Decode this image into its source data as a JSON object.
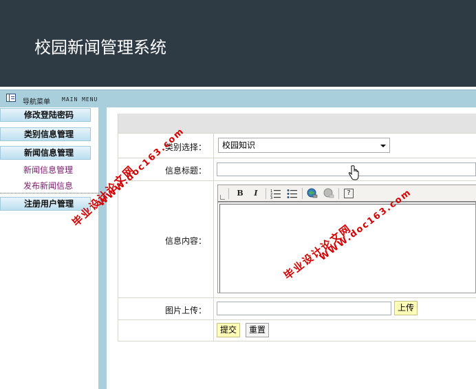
{
  "header": {
    "title": "校园新闻管理系统"
  },
  "navbar": {
    "label": "导航菜单",
    "sub_label": "MAIN MENU",
    "icon": "menu-icon"
  },
  "sidebar": {
    "items": [
      {
        "label": "修改登陆密码",
        "type": "head"
      },
      {
        "label": "类别信息管理",
        "type": "head"
      },
      {
        "label": "新闻信息管理",
        "type": "head"
      },
      {
        "label": "新闻信息管理",
        "type": "sub"
      },
      {
        "label": "发布新闻信息",
        "type": "sub"
      },
      {
        "label": "注册用户管理",
        "type": "head"
      }
    ]
  },
  "form": {
    "category_label": "类别选择：",
    "category_value": "校园知识",
    "title_label": "信息标题：",
    "title_value": "",
    "content_label": "信息内容：",
    "image_label": "图片上传：",
    "image_value": "",
    "upload_button": "上传",
    "submit_button": "提交",
    "reset_button": "重置"
  },
  "editor": {
    "toolbar": [
      "bold-icon",
      "italic-icon",
      "ordered-list-icon",
      "unordered-list-icon",
      "link-icon",
      "unlink-icon",
      "help-icon"
    ],
    "bold": "B",
    "italic": "I",
    "help": "?"
  },
  "watermarks": {
    "line1": "毕业设计论文网",
    "line2": "WWW.doc163.com"
  }
}
